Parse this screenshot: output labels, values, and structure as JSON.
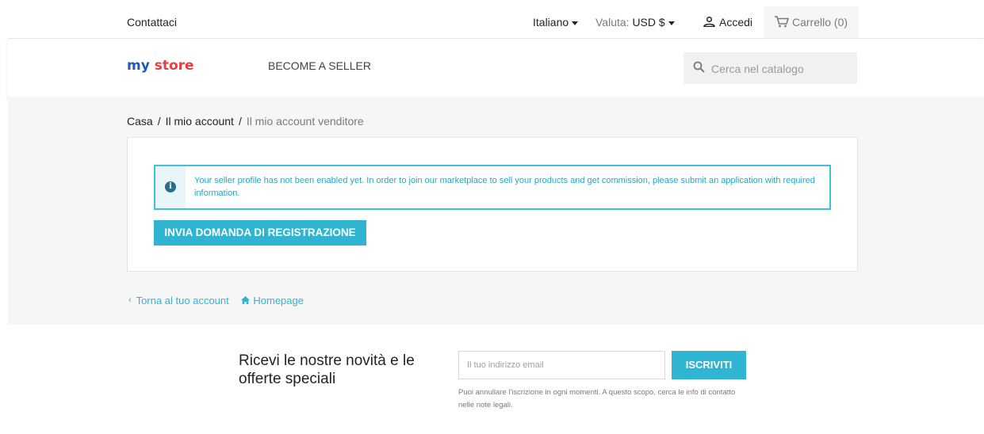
{
  "topbar": {
    "contact": "Contattaci",
    "language": "Italiano",
    "currency_label": "Valuta:",
    "currency_value": "USD $",
    "login": "Accedi",
    "cart": "Carrello (0)"
  },
  "header": {
    "logo_part1": "my",
    "logo_part2": "store",
    "nav_seller": "BECOME A SELLER",
    "search_placeholder": "Cerca nel catalogo"
  },
  "breadcrumb": {
    "items": [
      "Casa",
      "Il mio account",
      "Il mio account venditore"
    ],
    "separator": "/"
  },
  "alert": {
    "text": "Your seller profile has not been enabled yet. In order to join our marketplace to sell your products and get commission, please submit an application with required information."
  },
  "register_button": "INVIA DOMANDA DI REGISTRAZIONE",
  "footer_links": {
    "back": "Torna al tuo account",
    "home": "Homepage"
  },
  "newsletter": {
    "title": "Ricevi le nostre novità e le offerte speciali",
    "input_placeholder": "Il tuo indirizzo email",
    "button": "ISCRIVITI",
    "note": "Puoi annullare l'iscrizione in ogni momenti. A questo scopo, cerca le info di contatto nelle note legali."
  },
  "colors": {
    "accent": "#2fb5d2",
    "alert_text": "#25a7c4",
    "logo_blue": "#1f56b8",
    "logo_red": "#e73f3f"
  }
}
